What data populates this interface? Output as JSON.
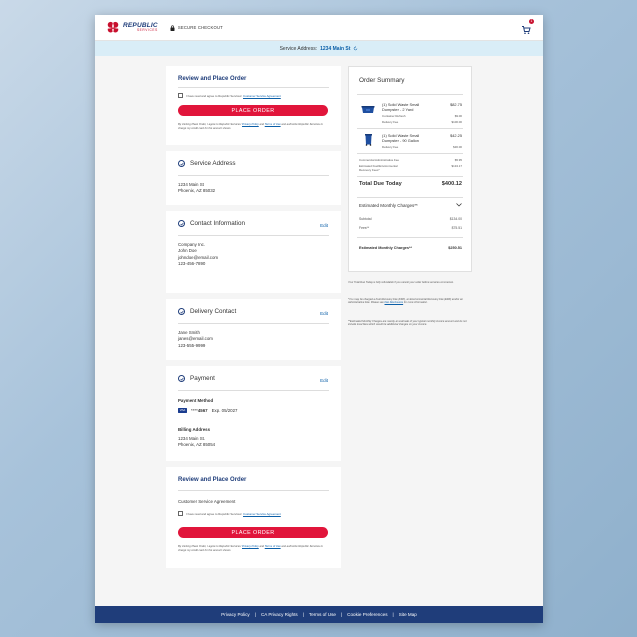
{
  "header": {
    "brand": "REPUBLIC",
    "brand_sub": "SERVICES",
    "secure_label": "SECURE CHECKOUT",
    "cart_count": "1",
    "logo_color": "#c8102e"
  },
  "address_bar": {
    "label": "Service Address:",
    "address": "1234 Main St"
  },
  "review_top": {
    "title": "Review and Place Order",
    "agree_text": "I have read and agree to Republic Services'",
    "agree_link": "Customer Service Agreement",
    "button": "PLACE ORDER",
    "legal_1": "By clicking Place Order, I agree to Republic Services'",
    "privacy_link": "Privacy Policy",
    "and": "and",
    "terms_link": "Terms of Use",
    "legal_2": "and authorize Republic Services to charge my credit card for the amount shown."
  },
  "service_address": {
    "title": "Service Address",
    "line1": "1234 Main St",
    "line2": "Phoenix, AZ 85032"
  },
  "contact": {
    "title": "Contact Information",
    "edit": "Edit",
    "company": "Company Inc.",
    "name": "John Doe",
    "email": "johndoe@email.com",
    "phone": "123-456-7890"
  },
  "delivery": {
    "title": "Delivery Contact",
    "edit": "Edit",
    "name": "Jane Smith",
    "email": "janes@email.com",
    "phone": "123-555-9999"
  },
  "payment": {
    "title": "Payment",
    "edit": "Edit",
    "method_label": "Payment Method",
    "card_brand": "VISA",
    "card_mask": "****",
    "card_last4": "4567",
    "card_exp": "Exp. 05/2027",
    "billing_label": "Billing Address",
    "billing_line1": "1234 Main St.",
    "billing_line2": "Phoenix, AZ 85054"
  },
  "review_bottom": {
    "title": "Review and Place Order",
    "agreement_label": "Customer Service Agreement",
    "agree_text": "I have read and agree to Republic Services'",
    "agree_link": "Customer Service Agreement",
    "button": "PLACE ORDER",
    "legal_1": "By clicking Place Order, I agree to Republic Services'",
    "privacy_link": "Privacy Policy",
    "and": "and",
    "terms_link": "Terms of Use",
    "legal_2": "and authorize Republic Services to charge my credit card for the amount shown."
  },
  "summary": {
    "title": "Order Summary",
    "item1": {
      "name_line1": "(1) Solid Waste Small",
      "name_line2": "Dumpster - 2 Yard",
      "price": "$82.75",
      "sub1_label": "Container Refresh",
      "sub1_value": "$9.00",
      "sub2_label": "Delivery Fee",
      "sub2_value": "$100.00"
    },
    "item2": {
      "name_line1": "(1) Solid Waste Small",
      "name_line2": "Dumpster - 90 Gallon",
      "price": "$42.25",
      "sub1_label": "Delivery Fee",
      "sub1_value": "$30.00"
    },
    "admin_fee_label": "Commercial Administrative Fee",
    "admin_fee_value": "$5.95",
    "fuel_fee_label_1": "Estimated Fuel/Environmental",
    "fuel_fee_label_2": "Recovery Fees*",
    "fuel_fee_value": "$134.17",
    "total_label": "Total Due Today",
    "total_value": "$400.12",
    "monthly_label": "Estimated Monthly Charges**",
    "subtotal_label": "Subtotal",
    "subtotal_value": "$134.00",
    "fees_label": "Fees**",
    "fees_value": "$75.51",
    "monthly_total_label": "Estimated Monthly Charges**",
    "monthly_total_value": "$250.51"
  },
  "notes": {
    "n1": "Your Total Due Today is fully refundable if you cancel your order before services commence.",
    "n2a": "*You may be charged a Fuel Recovery Fee (FRF), an Environmental Recovery Fee (ERF) and/or an Administrative Fee. Please see",
    "n2_link": "Fee Disclosures",
    "n2b": "for more information.",
    "n3": "**Estimated Monthly Charges are merely an estimate of your typical monthly invoice amount and do not include local fees which would be additional charges on your invoice."
  },
  "footer": {
    "links": [
      "Privacy Policy",
      "CA Privacy Rights",
      "Terms of Use",
      "Cookie Preferences",
      "Site Map"
    ],
    "separator": "|"
  },
  "colors": {
    "brand_blue": "#1f3d7a",
    "accent_red": "#e1153b",
    "link_blue": "#0b5fa8",
    "bar_blue": "#d9edf7"
  }
}
